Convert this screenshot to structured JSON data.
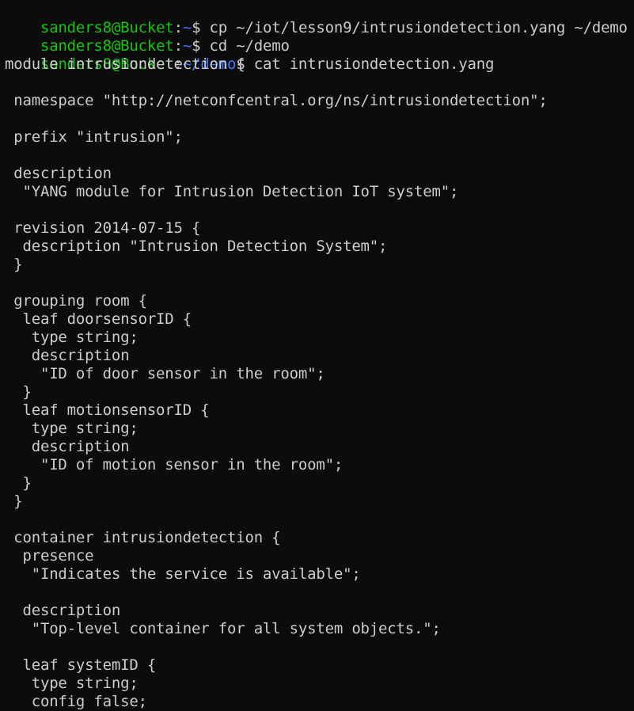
{
  "colors": {
    "background": "#0c0c0c",
    "foreground": "#cccccc",
    "prompt_user": "#16c60c",
    "prompt_path": "#3b78ff"
  },
  "prompts": [
    {
      "user": "sanders8@Bucket",
      "sep": ":",
      "path": "~",
      "dollar": "$",
      "command": " cp ~/iot/lesson9/intrusiondetection.yang ~/demo"
    },
    {
      "user": "sanders8@Bucket",
      "sep": ":",
      "path": "~",
      "dollar": "$",
      "command": " cd ~/demo"
    },
    {
      "user": "sanders8@Bucket",
      "sep": ":",
      "path": "~/demo",
      "dollar": "$",
      "command": " cat intrusiondetection.yang"
    }
  ],
  "output_lines": [
    "module intrusiondetection {",
    "",
    " namespace \"http://netconfcentral.org/ns/intrusiondetection\";",
    "",
    " prefix \"intrusion\";",
    "",
    " description",
    "  \"YANG module for Intrusion Detection IoT system\";",
    "",
    " revision 2014-07-15 {",
    "  description \"Intrusion Detection System\";",
    " }",
    "",
    " grouping room {",
    "  leaf doorsensorID {",
    "   type string;",
    "   description",
    "    \"ID of door sensor in the room\";",
    "  }",
    "  leaf motionsensorID {",
    "   type string;",
    "   description",
    "    \"ID of motion sensor in the room\";",
    "  }",
    " }",
    "",
    " container intrusiondetection {",
    "  presence",
    "   \"Indicates the service is available\";",
    "",
    "  description",
    "   \"Top-level container for all system objects.\";",
    "",
    "  leaf systemID {",
    "   type string;",
    "   config false;"
  ]
}
